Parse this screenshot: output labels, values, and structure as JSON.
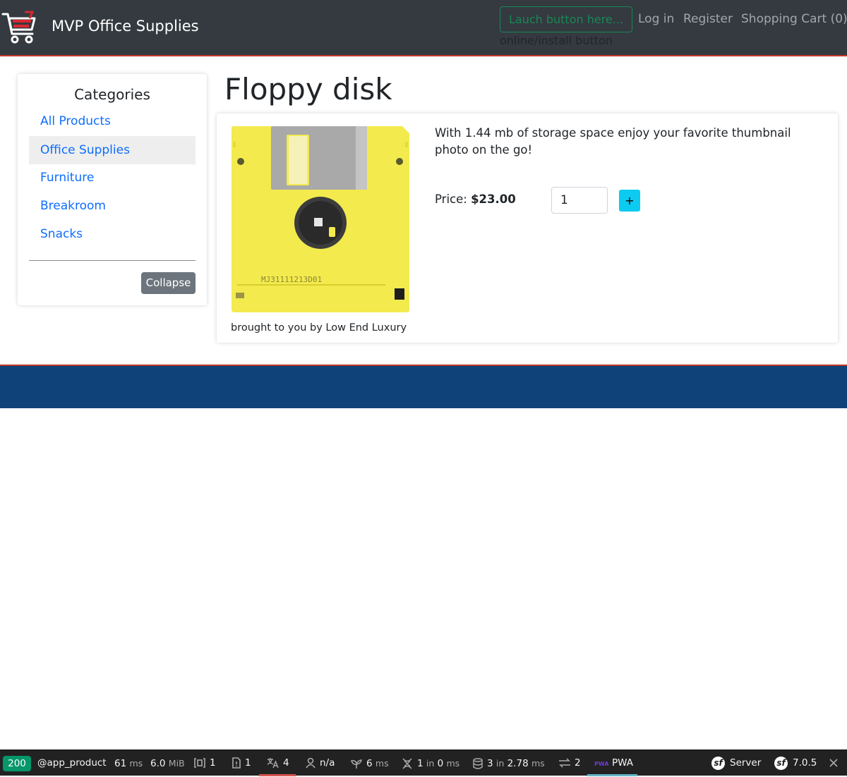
{
  "header": {
    "brand": "MVP Office Supplies",
    "launch_button": "Lauch button here...",
    "launch_caption": "online/install button",
    "nav": {
      "login": "Log in",
      "register": "Register",
      "cart": "Shopping Cart (0)"
    }
  },
  "sidebar": {
    "title": "Categories",
    "items": [
      {
        "label": "All Products"
      },
      {
        "label": "Office Supplies",
        "active": true
      },
      {
        "label": "Furniture"
      },
      {
        "label": "Breakroom"
      },
      {
        "label": "Snacks"
      }
    ],
    "collapse_label": "Collapse"
  },
  "product": {
    "title": "Floppy disk",
    "description": "With 1.44 mb of storage space enjoy your favorite thumbnail photo on the go!",
    "price_label": "Price:",
    "price_value": "$23.00",
    "quantity": "1",
    "add_label": "+",
    "image_caption": "brought to you by Low End Luxury",
    "disk_label_text": "MJ31111213D01"
  },
  "debug_toolbar": {
    "status": "200",
    "route": "@app_product",
    "time_value": "61",
    "time_unit": "ms",
    "memory_value": "6.0",
    "memory_unit": "MiB",
    "forms_count": "1",
    "logs_count": "1",
    "translations_count": "4",
    "user": "n/a",
    "twig_value": "6",
    "twig_unit": "ms",
    "cache_value": "1",
    "cache_in": "in",
    "cache_time": "0",
    "cache_unit": "ms",
    "db_value": "3",
    "db_in": "in",
    "db_time": "2.78",
    "db_unit": "ms",
    "http_count": "2",
    "pwa_label": "PWA",
    "server_label": "Server",
    "version": "7.0.5"
  },
  "colors": {
    "header_bg": "#343a40",
    "accent_red": "#c0392b",
    "link_blue": "#0d6efd",
    "footer_bg": "#0f4279",
    "add_button": "#0dcaf0",
    "launch_green": "#198754",
    "status_green": "#059669"
  },
  "icons": [
    "shopping-cart-logo",
    "floppy-disk-image",
    "forms-icon",
    "logs-icon",
    "translation-icon",
    "user-icon",
    "twig-icon",
    "cache-icon",
    "database-icon",
    "http-client-icon",
    "pwa-icon",
    "symfony-icon",
    "close-icon"
  ]
}
